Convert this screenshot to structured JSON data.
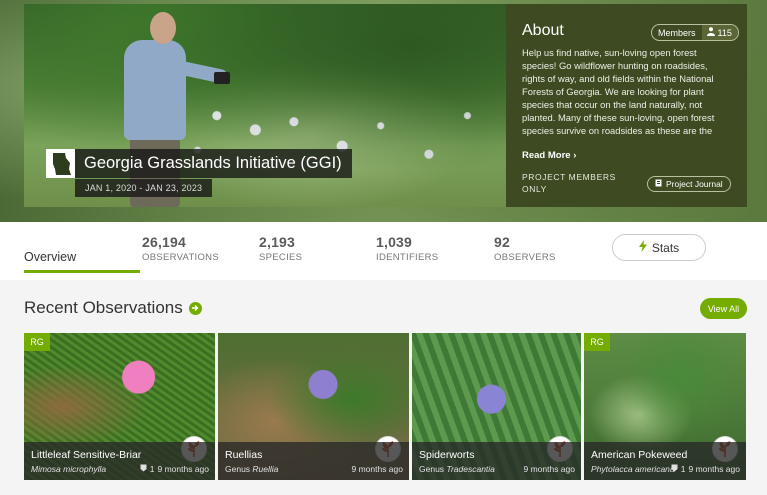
{
  "project": {
    "title": "Georgia Grasslands Initiative (GGI)",
    "date_range": "JAN 1, 2020 - JAN 23, 2023"
  },
  "about": {
    "heading": "About",
    "members_label": "Members",
    "members_count": "115",
    "text": "Help us find native, sun-loving open forest species! Go wildflower hunting on roadsides, rights of way, and old fields within the National Forests of Georgia. We are looking for plant species that occur on the land naturally, not planted. Many of these sun-loving, open forest species survive on roadsides as these are the",
    "read_more": "Read More ›",
    "members_only": "PROJECT MEMBERS ONLY",
    "journal_label": "Project Journal"
  },
  "stats": {
    "overview_tab": "Overview",
    "observations": {
      "value": "26,194",
      "label": "OBSERVATIONS"
    },
    "species": {
      "value": "2,193",
      "label": "SPECIES"
    },
    "identifiers": {
      "value": "1,039",
      "label": "IDENTIFIERS"
    },
    "observers": {
      "value": "92",
      "label": "OBSERVERS"
    },
    "stats_button": "Stats"
  },
  "recent": {
    "title": "Recent Observations",
    "view_all": "View All",
    "cards": [
      {
        "name": "Littleleaf Sensitive-Briar",
        "sci_prefix": "",
        "sci": "Mimosa microphylla",
        "ids": "1",
        "when": "9 months ago",
        "badge": "RG"
      },
      {
        "name": "Ruellias",
        "sci_prefix": "Genus ",
        "sci": "Ruellia",
        "ids": "",
        "when": "9 months ago",
        "badge": ""
      },
      {
        "name": "Spiderworts",
        "sci_prefix": "Genus ",
        "sci": "Tradescantia",
        "ids": "",
        "when": "9 months ago",
        "badge": ""
      },
      {
        "name": "American Pokeweed",
        "sci_prefix": "",
        "sci": "Phytolacca americana",
        "ids": "1",
        "when": "9 months ago",
        "badge": "RG"
      }
    ]
  },
  "colors": {
    "accent": "#74ac00",
    "about_bg": "#3d4a22"
  }
}
